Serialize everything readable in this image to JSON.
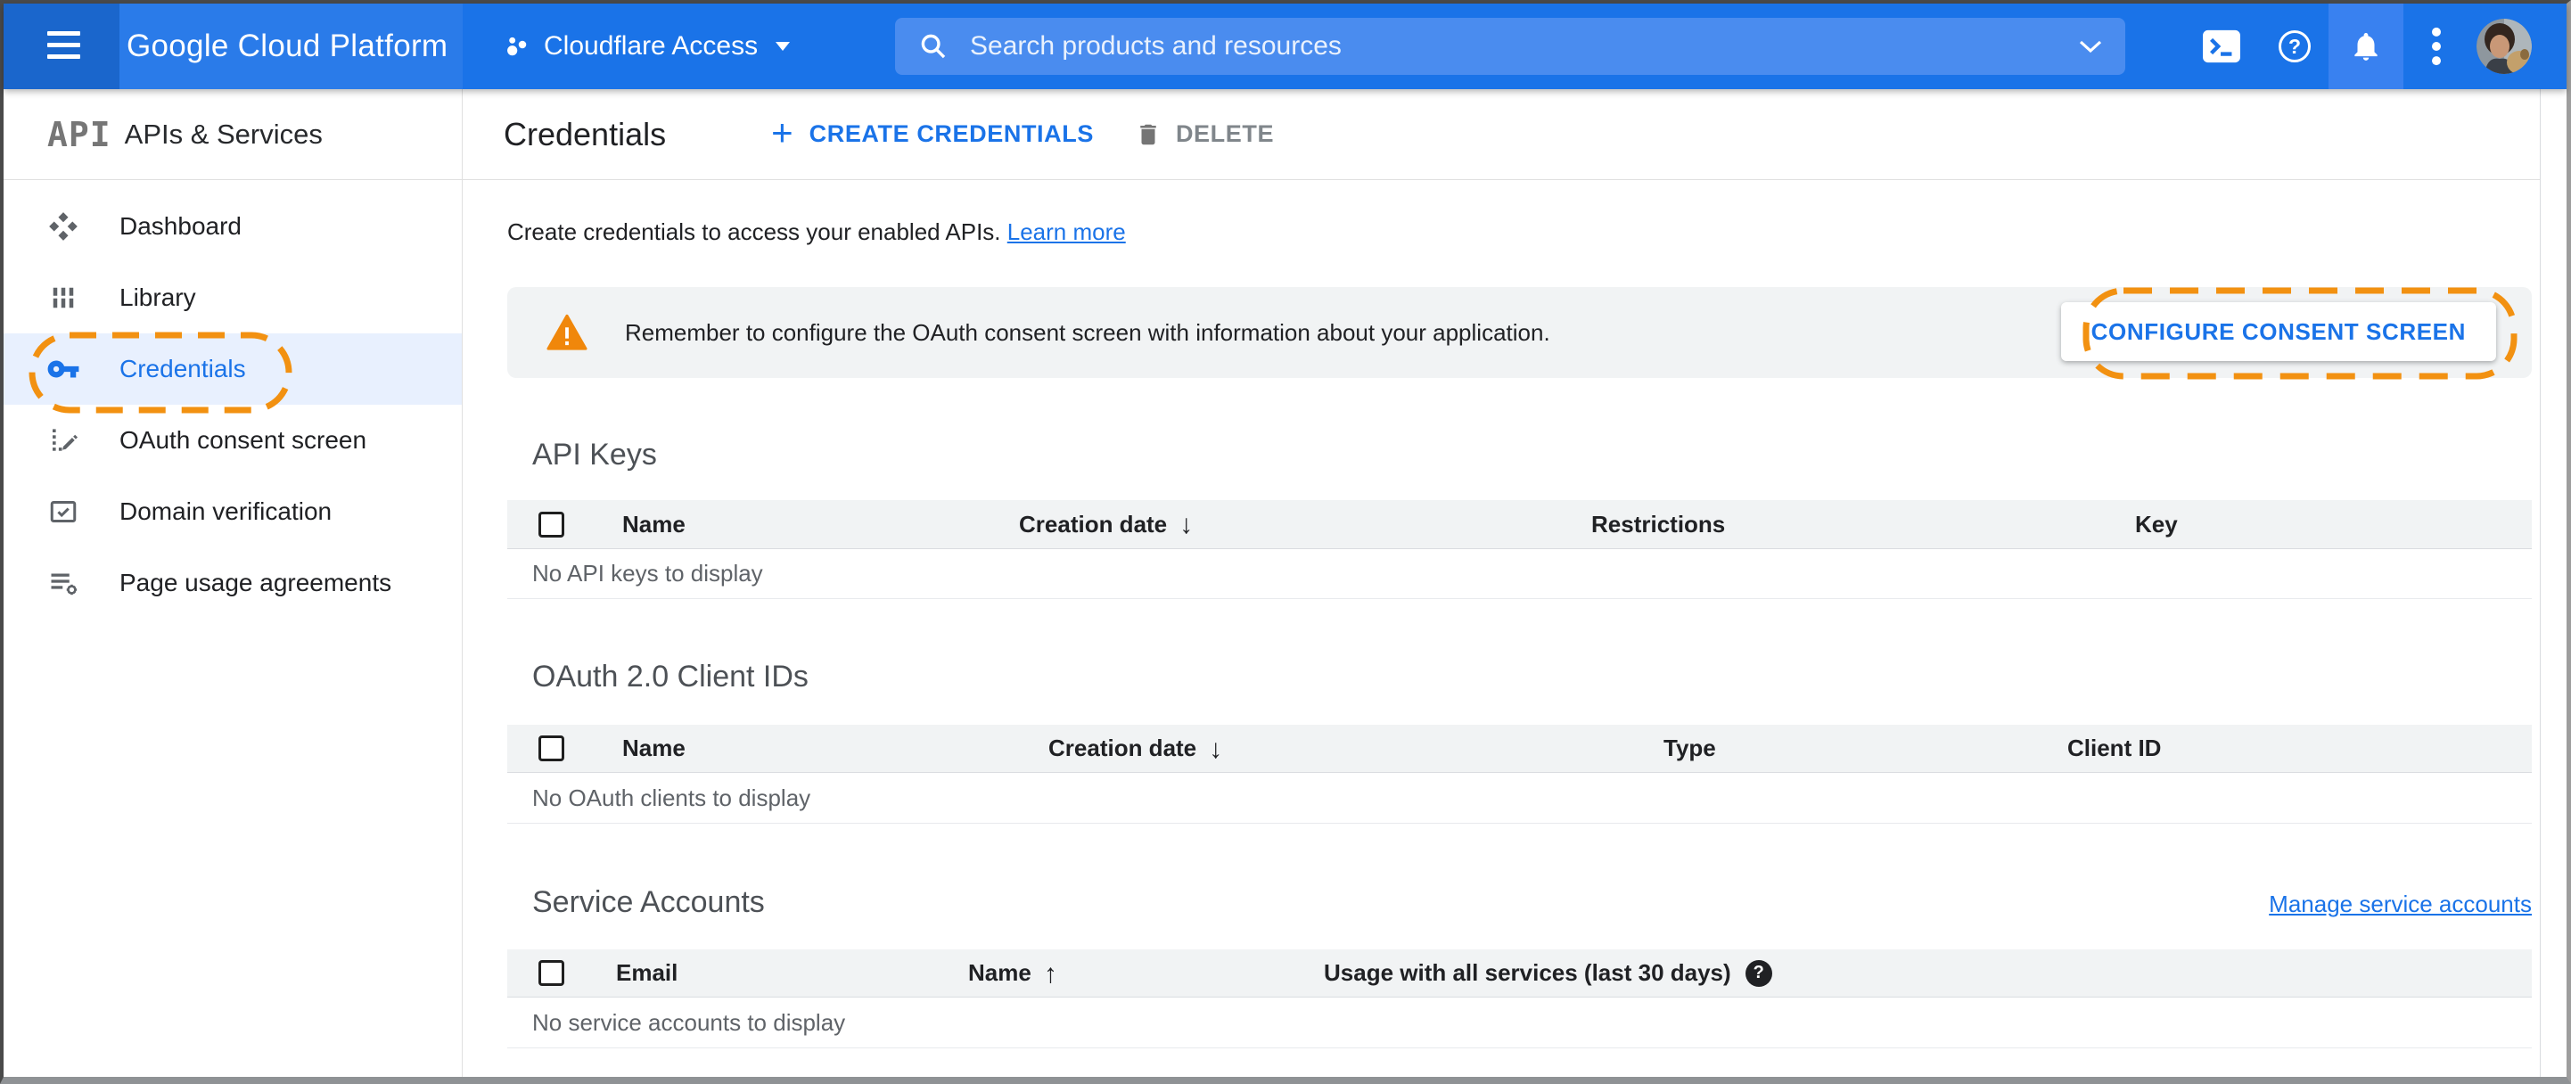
{
  "header": {
    "product_name": "Google Cloud Platform",
    "project_name": "Cloudflare Access",
    "search_placeholder": "Search products and resources"
  },
  "sidebar": {
    "logo_text": "API",
    "title": "APIs & Services",
    "items": [
      {
        "label": "Dashboard",
        "active": false
      },
      {
        "label": "Library",
        "active": false
      },
      {
        "label": "Credentials",
        "active": true,
        "annotated": true
      },
      {
        "label": "OAuth consent screen",
        "active": false
      },
      {
        "label": "Domain verification",
        "active": false
      },
      {
        "label": "Page usage agreements",
        "active": false
      }
    ]
  },
  "toolbar": {
    "title": "Credentials",
    "create_label": "CREATE CREDENTIALS",
    "delete_label": "DELETE"
  },
  "intro": {
    "text": "Create credentials to access your enabled APIs. ",
    "link_label": "Learn more"
  },
  "banner": {
    "message": "Remember to configure the OAuth consent screen with information about your application.",
    "button_label": "CONFIGURE CONSENT SCREEN"
  },
  "sections": {
    "api_keys": {
      "title": "API Keys",
      "columns": [
        "Name",
        "Creation date",
        "Restrictions",
        "Key"
      ],
      "sort": {
        "column": "Creation date",
        "direction": "desc"
      },
      "empty_text": "No API keys to display"
    },
    "oauth_clients": {
      "title": "OAuth 2.0 Client IDs",
      "columns": [
        "Name",
        "Creation date",
        "Type",
        "Client ID"
      ],
      "sort": {
        "column": "Creation date",
        "direction": "desc"
      },
      "empty_text": "No OAuth clients to display"
    },
    "service_accounts": {
      "title": "Service Accounts",
      "manage_link_label": "Manage service accounts",
      "columns": [
        "Email",
        "Name",
        "Usage with all services (last 30 days)"
      ],
      "sort": {
        "column": "Name",
        "direction": "asc"
      },
      "empty_text": "No service accounts to display"
    }
  },
  "icons": {
    "sort_desc_glyph": "↓",
    "sort_asc_glyph": "↑",
    "help_badge_glyph": "?",
    "plus_glyph": "+"
  },
  "colors": {
    "header_blue": "#1A73E8",
    "accent_blue": "#1A73E8",
    "active_nav_bg": "#E8F0FE",
    "annotation_orange": "#F29111",
    "warning_orange": "#F0870B",
    "banner_bg": "#F1F3F4",
    "table_header_bg": "#F1F3F4"
  }
}
